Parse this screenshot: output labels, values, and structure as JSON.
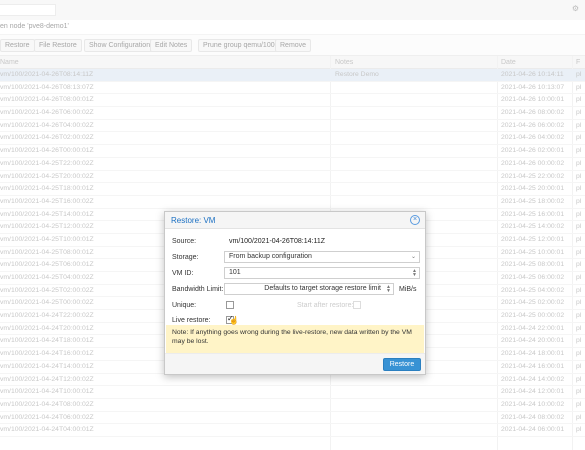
{
  "title": "en node 'pve8-demo1'",
  "toolbar": {
    "buttons": [
      "Restore",
      "File Restore",
      "Show Configuration",
      "Edit Notes",
      "Prune group qemu/100",
      "Remove"
    ]
  },
  "grid": {
    "headers": {
      "name": "Name",
      "notes": "Notes",
      "date": "Date",
      "fmt": "F"
    },
    "rows": [
      {
        "name": "vm/100/2021-04-26T08:14:11Z",
        "notes": "Restore Demo",
        "date": "2021-04-26 10:14:11",
        "fmt": "pl"
      },
      {
        "name": "vm/100/2021-04-26T08:13:07Z",
        "notes": "",
        "date": "2021-04-26 10:13:07",
        "fmt": "pl"
      },
      {
        "name": "vm/100/2021-04-26T08:00:01Z",
        "notes": "",
        "date": "2021-04-26 10:00:01",
        "fmt": "pl"
      },
      {
        "name": "vm/100/2021-04-26T06:00:02Z",
        "notes": "",
        "date": "2021-04-26 08:00:02",
        "fmt": "pl"
      },
      {
        "name": "vm/100/2021-04-26T04:00:02Z",
        "notes": "",
        "date": "2021-04-26 06:00:02",
        "fmt": "pl"
      },
      {
        "name": "vm/100/2021-04-26T02:00:02Z",
        "notes": "",
        "date": "2021-04-26 04:00:02",
        "fmt": "pl"
      },
      {
        "name": "vm/100/2021-04-26T00:00:01Z",
        "notes": "",
        "date": "2021-04-26 02:00:01",
        "fmt": "pl"
      },
      {
        "name": "vm/100/2021-04-25T22:00:02Z",
        "notes": "",
        "date": "2021-04-26 00:00:02",
        "fmt": "pl"
      },
      {
        "name": "vm/100/2021-04-25T20:00:02Z",
        "notes": "",
        "date": "2021-04-25 22:00:02",
        "fmt": "pl"
      },
      {
        "name": "vm/100/2021-04-25T18:00:01Z",
        "notes": "",
        "date": "2021-04-25 20:00:01",
        "fmt": "pl"
      },
      {
        "name": "vm/100/2021-04-25T16:00:02Z",
        "notes": "",
        "date": "2021-04-25 18:00:02",
        "fmt": "pl"
      },
      {
        "name": "vm/100/2021-04-25T14:00:01Z",
        "notes": "",
        "date": "2021-04-25 16:00:01",
        "fmt": "pl"
      },
      {
        "name": "vm/100/2021-04-25T12:00:02Z",
        "notes": "",
        "date": "2021-04-25 14:00:02",
        "fmt": "pl"
      },
      {
        "name": "vm/100/2021-04-25T10:00:01Z",
        "notes": "",
        "date": "2021-04-25 12:00:01",
        "fmt": "pl"
      },
      {
        "name": "vm/100/2021-04-25T08:00:01Z",
        "notes": "",
        "date": "2021-04-25 10:00:01",
        "fmt": "pl"
      },
      {
        "name": "vm/100/2021-04-25T06:00:01Z",
        "notes": "",
        "date": "2021-04-25 08:00:01",
        "fmt": "pl"
      },
      {
        "name": "vm/100/2021-04-25T04:00:02Z",
        "notes": "",
        "date": "2021-04-25 06:00:02",
        "fmt": "pl"
      },
      {
        "name": "vm/100/2021-04-25T02:00:02Z",
        "notes": "",
        "date": "2021-04-25 04:00:02",
        "fmt": "pl"
      },
      {
        "name": "vm/100/2021-04-25T00:00:02Z",
        "notes": "",
        "date": "2021-04-25 02:00:02",
        "fmt": "pl"
      },
      {
        "name": "vm/100/2021-04-24T22:00:02Z",
        "notes": "",
        "date": "2021-04-25 00:00:02",
        "fmt": "pl"
      },
      {
        "name": "vm/100/2021-04-24T20:00:01Z",
        "notes": "",
        "date": "2021-04-24 22:00:01",
        "fmt": "pl"
      },
      {
        "name": "vm/100/2021-04-24T18:00:01Z",
        "notes": "",
        "date": "2021-04-24 20:00:01",
        "fmt": "pl"
      },
      {
        "name": "vm/100/2021-04-24T16:00:01Z",
        "notes": "",
        "date": "2021-04-24 18:00:01",
        "fmt": "pl"
      },
      {
        "name": "vm/100/2021-04-24T14:00:01Z",
        "notes": "",
        "date": "2021-04-24 16:00:01",
        "fmt": "pl"
      },
      {
        "name": "vm/100/2021-04-24T12:00:02Z",
        "notes": "",
        "date": "2021-04-24 14:00:02",
        "fmt": "pl"
      },
      {
        "name": "vm/100/2021-04-24T10:00:01Z",
        "notes": "",
        "date": "2021-04-24 12:00:01",
        "fmt": "pl"
      },
      {
        "name": "vm/100/2021-04-24T08:00:02Z",
        "notes": "",
        "date": "2021-04-24 10:00:02",
        "fmt": "pl"
      },
      {
        "name": "vm/100/2021-04-24T06:00:02Z",
        "notes": "",
        "date": "2021-04-24 08:00:02",
        "fmt": "pl"
      },
      {
        "name": "vm/100/2021-04-24T04:00:01Z",
        "notes": "",
        "date": "2021-04-24 06:00:01",
        "fmt": "pl"
      }
    ]
  },
  "dialog": {
    "title": "Restore: VM",
    "source_label": "Source:",
    "source_value": "vm/100/2021-04-26T08:14:11Z",
    "storage_label": "Storage:",
    "storage_value": "From backup configuration",
    "vmid_label": "VM ID:",
    "vmid_value": "101",
    "bandwidth_label": "Bandwidth Limit:",
    "bandwidth_value": "Defaults to target storage restore limit",
    "bandwidth_unit": "MiB/s",
    "unique_label": "Unique:",
    "start_label": "Start after restore:",
    "live_label": "Live restore:",
    "note": "Note: If anything goes wrong during the live-restore, new data written by the VM may be lost.",
    "restore_button": "Restore"
  },
  "icons": {
    "close": "close-circle-icon",
    "dropdown": "chevron-down-icon",
    "spinner": "spinner-icon"
  },
  "colors": {
    "accent": "#3892d4",
    "title": "#1a6fc2",
    "note_bg": "#fff4c7",
    "selected_row": "#dfe8f3"
  }
}
